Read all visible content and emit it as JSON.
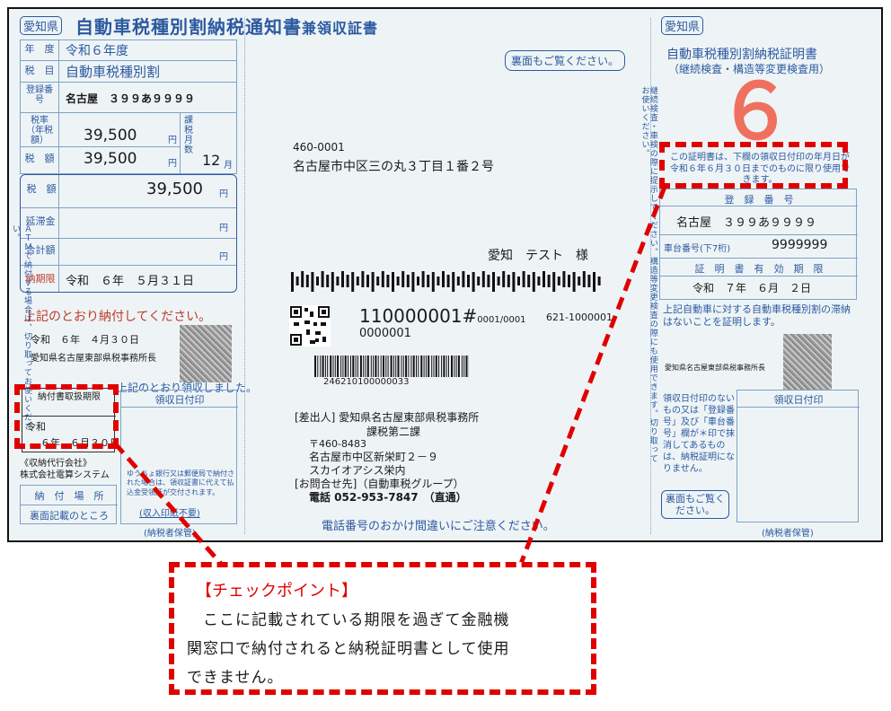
{
  "left": {
    "pref_badge": "愛知県",
    "title": "自動車税種別割納税通知書",
    "title_suffix": "兼領収証書",
    "rows": [
      {
        "label": "年　度",
        "value": "令和６年度"
      },
      {
        "label": "税　目",
        "value": "自動車税種別割"
      },
      {
        "label": "登録番号",
        "value": "名古屋　３９９あ９９９９"
      }
    ],
    "tax_rate_label": "税率（年税額）",
    "tax_rate_value": "39,500",
    "tax_amount_label": "税　額",
    "tax_amount_value": "39,500",
    "yen": "円",
    "months_label": "課税月数",
    "months_value": "12",
    "months_unit": "月",
    "total_label": "税　額",
    "total_value": "39,500",
    "late_label": "延滞金",
    "sum_label": "合計額",
    "deadline_label": "納期限",
    "deadline_value": "令和　６年　５月３１日",
    "pay_notice": "上記のとおり納付してください。",
    "issue_date": "令和　６年　４月３０日",
    "issuer": "愛知県名古屋東部県税事務所長",
    "receipt_notice": "上記のとおり領収しました。",
    "deadline_box_title": "納付書取扱期限",
    "deadline_box_era": "令和",
    "deadline_box_date": "６年　６月３０日",
    "agent_label": "《収納代行会社》",
    "agent_name": "株式会社電算システム",
    "pay_place_label": "納　付　場　所",
    "pay_place_value": "裏面記載のところ",
    "stamp_header": "領収日付印",
    "postal_note": "ゆうちょ銀行又は郵便局で納付された場合は、領収証書に代えて払込金受領証が交付されます。",
    "stamp_free": "(収入印紙不要)",
    "keep_note": "(納税者保管)"
  },
  "center": {
    "see_back": "裏面もご覧ください。",
    "zip": "460-0001",
    "address": "名古屋市中区三の丸３丁目１番２号",
    "name": "愛知　テスト　様",
    "notice_no": "110000001#",
    "notice_sub": "0001/0001",
    "code": "621-1000001",
    "sub_no": "0000001",
    "barcode_no": "246210100000033",
    "sender_label": "[差出人]",
    "sender": "愛知県名古屋東部県税事務所",
    "sender_div": "課税第二課",
    "sender_zip": "〒460-8483",
    "sender_addr": "名古屋市中区新栄町２－９",
    "sender_bldg": "スカイオアシス栄内",
    "contact_label": "[お問合せ先]（自動車税グループ）",
    "phone": "電話 052-953-7847　（直通）",
    "phone_warning": "電話番号のおかけ間違いにご注意ください。"
  },
  "right": {
    "pref_badge": "愛知県",
    "title": "自動車税種別割納税証明書",
    "subtitle": "（継続検査・構造等変更検査用）",
    "big_number": "６",
    "validity_notice": "この証明書は、下欄の領収日付印の年月日が令和６年６月３０日までのものに限り使用できます。",
    "reg_header": "登　録　番　号",
    "reg_value": "名古屋　３９９あ９９９９",
    "chassis_label": "車台番号(下7桁)",
    "chassis_value": "9999999",
    "valid_header": "証　明　書　有　効　期　限",
    "valid_value": "令和　７年　６月　２日",
    "cert_text": "上記自動車に対する自動車税種別割の滞納はないことを証明します。",
    "issuer": "愛知県名古屋東部県税事務所長",
    "stamp_note": "領収日付印のないもの又は「登録番号」及び「車台番号」欄が＊印で抹消してあるものは、納税証明になりません。",
    "see_back": "裏面もご覧ください。",
    "stamp_header": "領収日付印",
    "keep_note": "(納税者保管)",
    "vertical_note": "継続検査・車検の際に提示してください。構造等変更検査の際にも使用できます。切り取ってお使いください。"
  },
  "left_vertical_note": "ＡＴＭで納付する場合は、切り取ってお使いください。",
  "callout": {
    "title": "【チェックポイント】",
    "body_line1": "　ここに記載されている期限を過ぎて金融機",
    "body_line2": "関窓口で納付されると納税証明書として使用",
    "body_line3": "できません。"
  },
  "colors": {
    "accent_blue": "#2c59a0",
    "alert_red": "#e00000",
    "paper": "#eef4f6"
  }
}
